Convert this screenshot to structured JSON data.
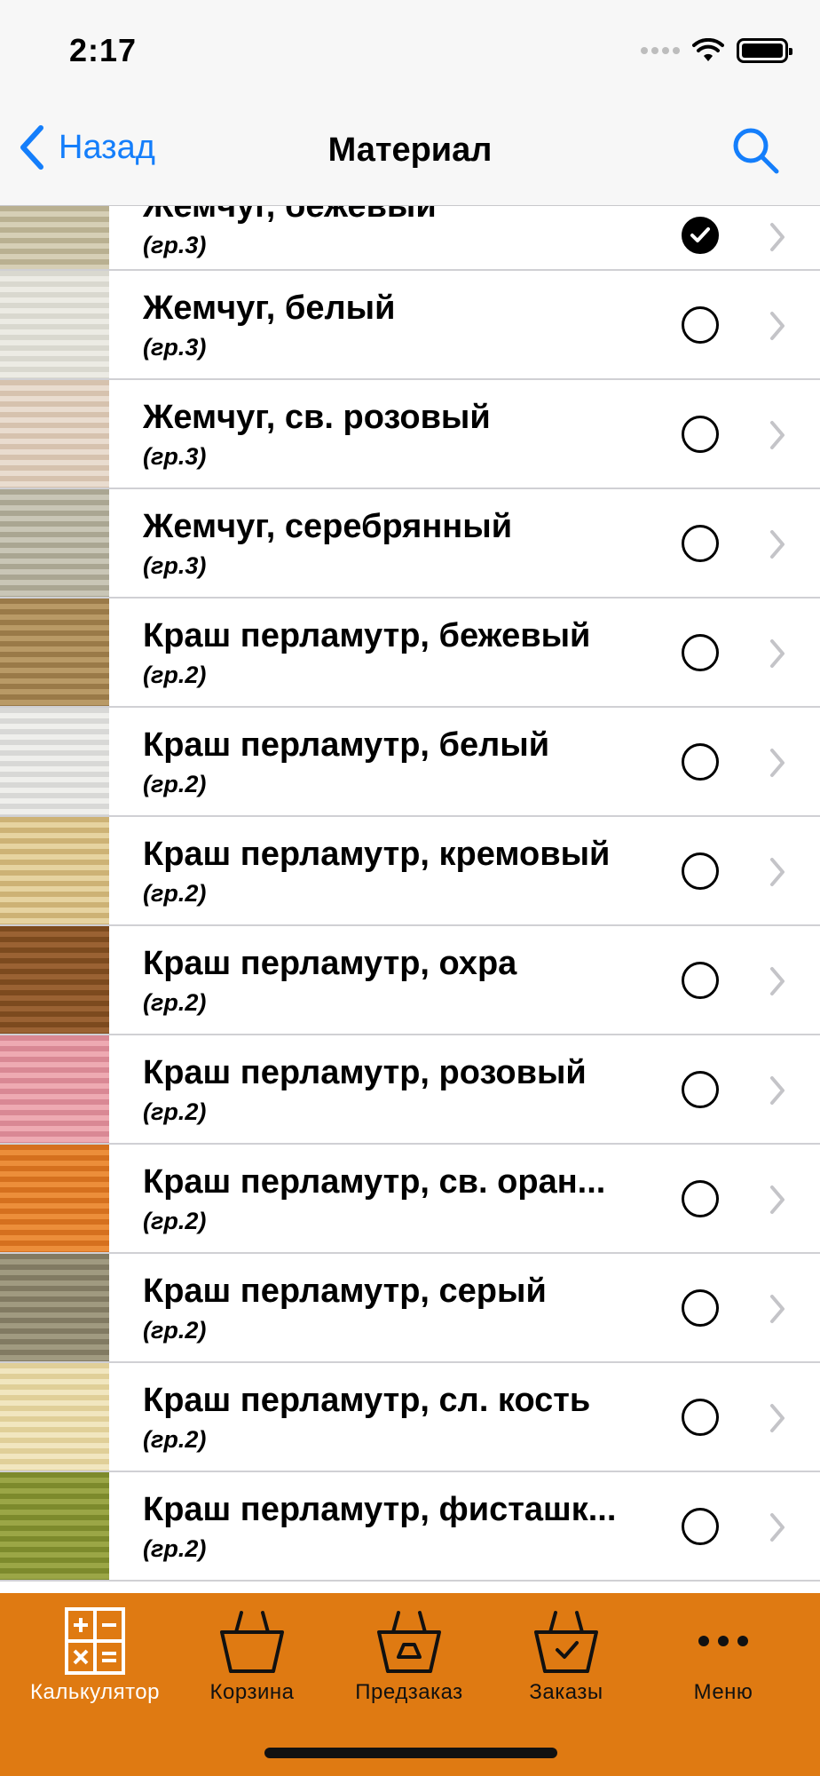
{
  "status_bar": {
    "time": "2:17"
  },
  "nav": {
    "back_label": "Назад",
    "title": "Материал"
  },
  "list": {
    "items": [
      {
        "title": "Жемчуг, бежевый",
        "group": "(гр.3)",
        "selected": true,
        "swatch": [
          "#b9b091",
          "#d6cfb6"
        ]
      },
      {
        "title": "Жемчуг, белый",
        "group": "(гр.3)",
        "selected": false,
        "swatch": [
          "#d9d8cf",
          "#ecebe4"
        ]
      },
      {
        "title": "Жемчуг, св. розовый",
        "group": "(гр.3)",
        "selected": false,
        "swatch": [
          "#d6c2ae",
          "#e9dccf"
        ]
      },
      {
        "title": "Жемчуг, серебрянный",
        "group": "(гр.3)",
        "selected": false,
        "swatch": [
          "#aaa692",
          "#c9c6b6"
        ]
      },
      {
        "title": "Краш перламутр, бежевый",
        "group": "(гр.2)",
        "selected": false,
        "swatch": [
          "#9a7a48",
          "#b99a66"
        ]
      },
      {
        "title": "Краш перламутр, белый",
        "group": "(гр.2)",
        "selected": false,
        "swatch": [
          "#d8d8d6",
          "#efefec"
        ]
      },
      {
        "title": "Краш перламутр, кремовый",
        "group": "(гр.2)",
        "selected": false,
        "swatch": [
          "#cdb275",
          "#e6d3a0"
        ]
      },
      {
        "title": "Краш перламутр, охра",
        "group": "(гр.2)",
        "selected": false,
        "swatch": [
          "#7c4a1e",
          "#9a6233"
        ]
      },
      {
        "title": "Краш перламутр, розовый",
        "group": "(гр.2)",
        "selected": false,
        "swatch": [
          "#d98894",
          "#eeaab2"
        ]
      },
      {
        "title": "Краш перламутр, св. оран...",
        "group": "(гр.2)",
        "selected": false,
        "swatch": [
          "#d5701e",
          "#ec8e3a"
        ]
      },
      {
        "title": "Краш перламутр, серый",
        "group": "(гр.2)",
        "selected": false,
        "swatch": [
          "#817a62",
          "#a09a80"
        ]
      },
      {
        "title": "Краш перламутр, сл. кость",
        "group": "(гр.2)",
        "selected": false,
        "swatch": [
          "#e0cf98",
          "#f1e6bf"
        ]
      },
      {
        "title": "Краш перламутр, фисташк...",
        "group": "(гр.2)",
        "selected": false,
        "swatch": [
          "#7d8a2c",
          "#9ba646"
        ]
      }
    ]
  },
  "tabbar": {
    "color": "#df7a12",
    "tabs": [
      {
        "label": "Калькулятор",
        "icon": "calculator-icon",
        "active": true
      },
      {
        "label": "Корзина",
        "icon": "basket-icon",
        "active": false
      },
      {
        "label": "Предзаказ",
        "icon": "preorder-basket-icon",
        "active": false
      },
      {
        "label": "Заказы",
        "icon": "orders-basket-icon",
        "active": false
      },
      {
        "label": "Меню",
        "icon": "more-icon",
        "active": false
      }
    ]
  },
  "colors": {
    "accent": "#147efb",
    "separator": "#d0d0d4"
  }
}
